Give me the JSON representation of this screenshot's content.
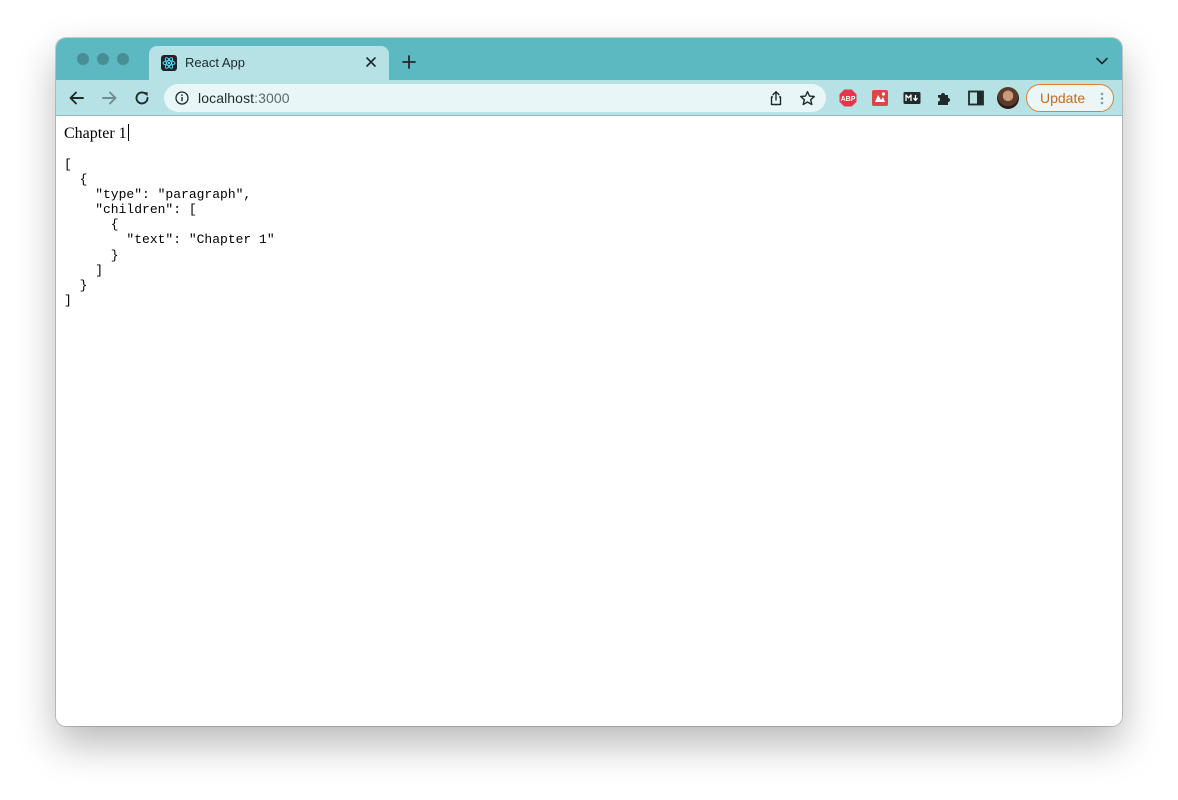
{
  "browser": {
    "tab": {
      "title": "React App",
      "icon": "react-icon"
    },
    "address_bar": {
      "host": "localhost",
      "port": ":3000"
    },
    "update_label": "Update",
    "colors": {
      "frame": "#5cb9c2",
      "toolbar": "#b6e1e5",
      "update_accent": "#d9823a"
    },
    "extensions": [
      "adblock-plus-icon",
      "red-extension-icon",
      "markdown-icon",
      "puzzle-icon",
      "side-panel-icon"
    ]
  },
  "page": {
    "editor_text": "Chapter 1",
    "json_output": "[\n  {\n    \"type\": \"paragraph\",\n    \"children\": [\n      {\n        \"text\": \"Chapter 1\"\n      }\n    ]\n  }\n]"
  }
}
